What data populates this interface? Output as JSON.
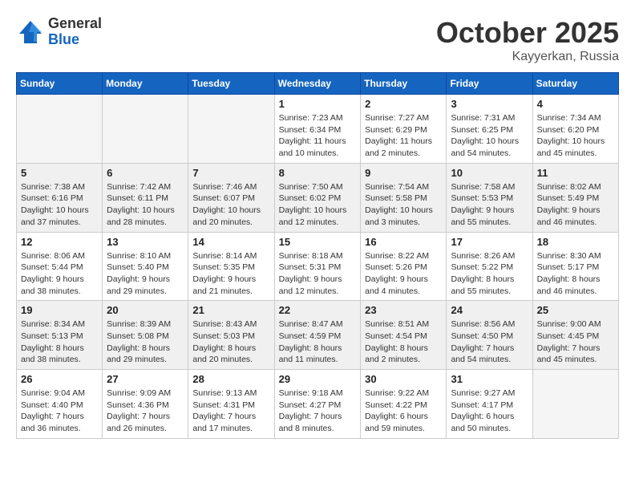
{
  "header": {
    "logo_general": "General",
    "logo_blue": "Blue",
    "month_title": "October 2025",
    "location": "Kayyerkan, Russia"
  },
  "days_of_week": [
    "Sunday",
    "Monday",
    "Tuesday",
    "Wednesday",
    "Thursday",
    "Friday",
    "Saturday"
  ],
  "weeks": [
    [
      {
        "day": "",
        "info": ""
      },
      {
        "day": "",
        "info": ""
      },
      {
        "day": "",
        "info": ""
      },
      {
        "day": "1",
        "info": "Sunrise: 7:23 AM\nSunset: 6:34 PM\nDaylight: 11 hours\nand 10 minutes."
      },
      {
        "day": "2",
        "info": "Sunrise: 7:27 AM\nSunset: 6:29 PM\nDaylight: 11 hours\nand 2 minutes."
      },
      {
        "day": "3",
        "info": "Sunrise: 7:31 AM\nSunset: 6:25 PM\nDaylight: 10 hours\nand 54 minutes."
      },
      {
        "day": "4",
        "info": "Sunrise: 7:34 AM\nSunset: 6:20 PM\nDaylight: 10 hours\nand 45 minutes."
      }
    ],
    [
      {
        "day": "5",
        "info": "Sunrise: 7:38 AM\nSunset: 6:16 PM\nDaylight: 10 hours\nand 37 minutes."
      },
      {
        "day": "6",
        "info": "Sunrise: 7:42 AM\nSunset: 6:11 PM\nDaylight: 10 hours\nand 28 minutes."
      },
      {
        "day": "7",
        "info": "Sunrise: 7:46 AM\nSunset: 6:07 PM\nDaylight: 10 hours\nand 20 minutes."
      },
      {
        "day": "8",
        "info": "Sunrise: 7:50 AM\nSunset: 6:02 PM\nDaylight: 10 hours\nand 12 minutes."
      },
      {
        "day": "9",
        "info": "Sunrise: 7:54 AM\nSunset: 5:58 PM\nDaylight: 10 hours\nand 3 minutes."
      },
      {
        "day": "10",
        "info": "Sunrise: 7:58 AM\nSunset: 5:53 PM\nDaylight: 9 hours\nand 55 minutes."
      },
      {
        "day": "11",
        "info": "Sunrise: 8:02 AM\nSunset: 5:49 PM\nDaylight: 9 hours\nand 46 minutes."
      }
    ],
    [
      {
        "day": "12",
        "info": "Sunrise: 8:06 AM\nSunset: 5:44 PM\nDaylight: 9 hours\nand 38 minutes."
      },
      {
        "day": "13",
        "info": "Sunrise: 8:10 AM\nSunset: 5:40 PM\nDaylight: 9 hours\nand 29 minutes."
      },
      {
        "day": "14",
        "info": "Sunrise: 8:14 AM\nSunset: 5:35 PM\nDaylight: 9 hours\nand 21 minutes."
      },
      {
        "day": "15",
        "info": "Sunrise: 8:18 AM\nSunset: 5:31 PM\nDaylight: 9 hours\nand 12 minutes."
      },
      {
        "day": "16",
        "info": "Sunrise: 8:22 AM\nSunset: 5:26 PM\nDaylight: 9 hours\nand 4 minutes."
      },
      {
        "day": "17",
        "info": "Sunrise: 8:26 AM\nSunset: 5:22 PM\nDaylight: 8 hours\nand 55 minutes."
      },
      {
        "day": "18",
        "info": "Sunrise: 8:30 AM\nSunset: 5:17 PM\nDaylight: 8 hours\nand 46 minutes."
      }
    ],
    [
      {
        "day": "19",
        "info": "Sunrise: 8:34 AM\nSunset: 5:13 PM\nDaylight: 8 hours\nand 38 minutes."
      },
      {
        "day": "20",
        "info": "Sunrise: 8:39 AM\nSunset: 5:08 PM\nDaylight: 8 hours\nand 29 minutes."
      },
      {
        "day": "21",
        "info": "Sunrise: 8:43 AM\nSunset: 5:03 PM\nDaylight: 8 hours\nand 20 minutes."
      },
      {
        "day": "22",
        "info": "Sunrise: 8:47 AM\nSunset: 4:59 PM\nDaylight: 8 hours\nand 11 minutes."
      },
      {
        "day": "23",
        "info": "Sunrise: 8:51 AM\nSunset: 4:54 PM\nDaylight: 8 hours\nand 2 minutes."
      },
      {
        "day": "24",
        "info": "Sunrise: 8:56 AM\nSunset: 4:50 PM\nDaylight: 7 hours\nand 54 minutes."
      },
      {
        "day": "25",
        "info": "Sunrise: 9:00 AM\nSunset: 4:45 PM\nDaylight: 7 hours\nand 45 minutes."
      }
    ],
    [
      {
        "day": "26",
        "info": "Sunrise: 9:04 AM\nSunset: 4:40 PM\nDaylight: 7 hours\nand 36 minutes."
      },
      {
        "day": "27",
        "info": "Sunrise: 9:09 AM\nSunset: 4:36 PM\nDaylight: 7 hours\nand 26 minutes."
      },
      {
        "day": "28",
        "info": "Sunrise: 9:13 AM\nSunset: 4:31 PM\nDaylight: 7 hours\nand 17 minutes."
      },
      {
        "day": "29",
        "info": "Sunrise: 9:18 AM\nSunset: 4:27 PM\nDaylight: 7 hours\nand 8 minutes."
      },
      {
        "day": "30",
        "info": "Sunrise: 9:22 AM\nSunset: 4:22 PM\nDaylight: 6 hours\nand 59 minutes."
      },
      {
        "day": "31",
        "info": "Sunrise: 9:27 AM\nSunset: 4:17 PM\nDaylight: 6 hours\nand 50 minutes."
      },
      {
        "day": "",
        "info": ""
      }
    ]
  ]
}
